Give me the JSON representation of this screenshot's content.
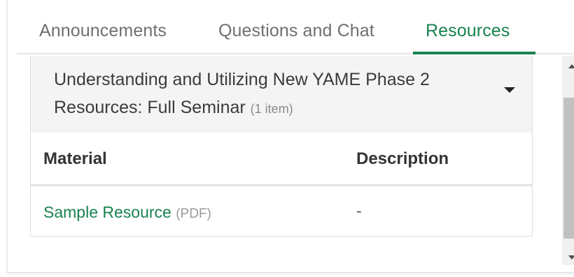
{
  "tabs": [
    {
      "label": "Announcements",
      "active": false
    },
    {
      "label": "Questions and Chat",
      "active": false
    },
    {
      "label": "Resources",
      "active": true
    }
  ],
  "accent_color": "#17834f",
  "resources": {
    "section_title": "Understanding and Utilizing New YAME Phase 2 Resources: Full Seminar",
    "section_count": "(1 item)",
    "expand_icon": "chevron-down-icon",
    "table": {
      "headers": [
        "Material",
        "Description"
      ],
      "rows": [
        {
          "material": "Sample Resource",
          "type": "(PDF)",
          "description": "-"
        }
      ]
    }
  },
  "scrollbar": {
    "up_icon": "scroll-up-arrow-icon",
    "down_icon": "scroll-down-arrow-icon"
  }
}
